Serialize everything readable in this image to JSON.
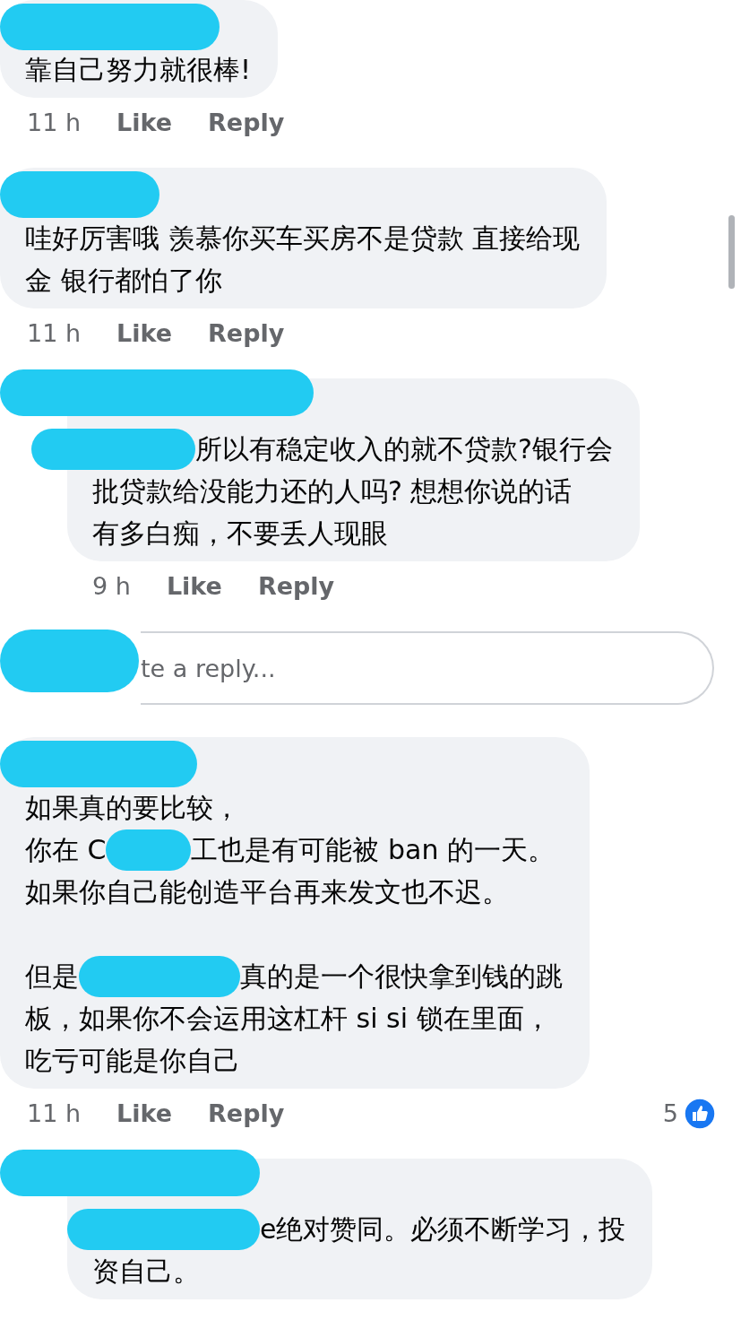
{
  "items": [
    {
      "kind": "comment",
      "reply": false,
      "paragraphs": [
        [
          [
            {
              "kind": "text",
              "text": "靠自己努力就很棒!"
            }
          ]
        ]
      ],
      "time": "11 h",
      "actions": [
        "Like",
        "Reply"
      ]
    },
    {
      "kind": "comment",
      "reply": false,
      "paragraphs": [
        [
          [
            {
              "kind": "text",
              "text": "哇好厉害哦 羡慕你买车买房不是贷款 直接给现"
            }
          ],
          [
            {
              "kind": "text",
              "text": "金 银行都怕了你"
            }
          ]
        ]
      ],
      "time": "11 h",
      "actions": [
        "Like",
        "Reply"
      ]
    },
    {
      "kind": "comment",
      "reply": true,
      "paragraphs": [
        [
          [
            {
              "kind": "redaction"
            },
            {
              "kind": "text",
              "text": "所以有稳定收入的就不贷款?银行会"
            }
          ],
          [
            {
              "kind": "text",
              "text": "批贷款给没能力还的人吗? 想想你说的话"
            }
          ],
          [
            {
              "kind": "text",
              "text": "有多白痴，不要丢人现眼"
            }
          ]
        ]
      ],
      "time": "9 h",
      "actions": [
        "Like",
        "Reply"
      ]
    },
    {
      "kind": "reply_box",
      "placeholder": "te a reply..."
    },
    {
      "kind": "comment",
      "reply": false,
      "paragraphs": [
        [
          [
            {
              "kind": "text",
              "text": "如果真的要比较，"
            }
          ],
          [
            {
              "kind": "text",
              "text": "你在 C"
            },
            {
              "kind": "redaction"
            },
            {
              "kind": "text",
              "text": "工也是有可能被 ban 的一天。"
            }
          ],
          [
            {
              "kind": "text",
              "text": "如果你自己能创造平台再来发文也不迟。"
            }
          ]
        ],
        [
          [
            {
              "kind": "text",
              "text": "但是"
            },
            {
              "kind": "redaction"
            },
            {
              "kind": "text",
              "text": "真的是一个很快拿到钱的跳"
            }
          ],
          [
            {
              "kind": "text",
              "text": "板，如果你不会运用这杠杆 si si 锁在里面，"
            }
          ],
          [
            {
              "kind": "text",
              "text": "吃亏可能是你自己"
            }
          ]
        ]
      ],
      "time": "11 h",
      "actions": [
        "Like",
        "Reply"
      ],
      "reactions": "5"
    },
    {
      "kind": "comment",
      "reply": true,
      "paragraphs": [
        [
          [
            {
              "kind": "redaction"
            },
            {
              "kind": "text",
              "text": "e绝对赞同。必须不断学习，投"
            }
          ],
          [
            {
              "kind": "text",
              "text": "资自己。"
            }
          ]
        ]
      ]
    }
  ]
}
